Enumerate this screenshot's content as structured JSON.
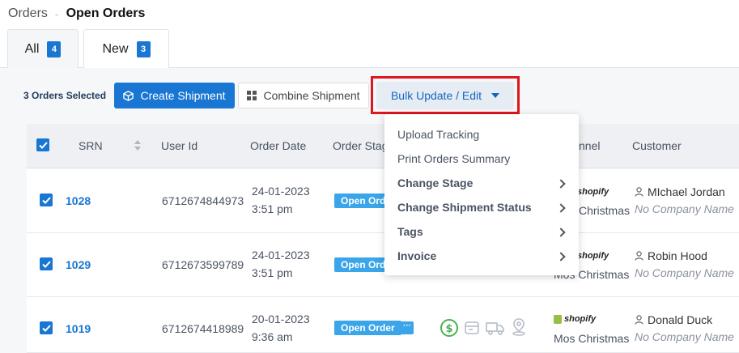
{
  "breadcrumb": {
    "root": "Orders",
    "current": "Open Orders"
  },
  "tabs": [
    {
      "label": "All",
      "count": "4"
    },
    {
      "label": "New",
      "count": "3"
    }
  ],
  "toolbar": {
    "selected": "3 Orders Selected",
    "create": "Create Shipment",
    "combine": "Combine Shipment",
    "bulk": "Bulk Update / Edit"
  },
  "table": {
    "headers": {
      "srn": "SRN",
      "user_id": "User Id",
      "order_date": "Order Date",
      "order_stage": "Order Stag",
      "channel": "nnel",
      "customer": "Customer"
    },
    "rows": [
      {
        "srn": "1028",
        "user_id": "6712674844973",
        "date": "24-01-2023",
        "time": "3:51 pm",
        "stage": "Open Order",
        "channel_logo": "shopify",
        "channel": "Mos Christmas",
        "customer": "MIchael Jordan",
        "company": "No Company Name"
      },
      {
        "srn": "1029",
        "user_id": "6712673599789",
        "date": "24-01-2023",
        "time": "3:51 pm",
        "stage": "Open Order",
        "channel_logo": "shopify",
        "channel": "Mos Christmas",
        "customer": "Robin Hood",
        "company": "No Company Name"
      },
      {
        "srn": "1019",
        "user_id": "6712674418989",
        "date": "20-01-2023",
        "time": "9:36 am",
        "stage": "Open Order",
        "more": "···",
        "channel_logo": "shopify",
        "channel": "Mos Christmas",
        "customer": "Donald Duck",
        "company": "No Company Name"
      }
    ]
  },
  "bulk_menu": {
    "items": [
      {
        "label": "Upload Tracking"
      },
      {
        "label": "Print Orders Summary"
      },
      {
        "label": "Change Stage"
      },
      {
        "label": "Change Shipment Status"
      },
      {
        "label": "Tags"
      },
      {
        "label": "Invoice"
      }
    ]
  },
  "colors": {
    "primary": "#1976d2",
    "stage": "#3aa5e8",
    "highlight": "#e0161c",
    "shopify": "#95bf47",
    "paid": "#4caf50"
  },
  "icons": [
    "box-icon",
    "grid-icon",
    "caret-down-icon",
    "checkbox-icon",
    "sort-icon",
    "person-icon",
    "dollar-icon",
    "invoice-icon",
    "truck-icon",
    "location-pin-icon",
    "chevron-right-icon",
    "shopify-logo"
  ]
}
